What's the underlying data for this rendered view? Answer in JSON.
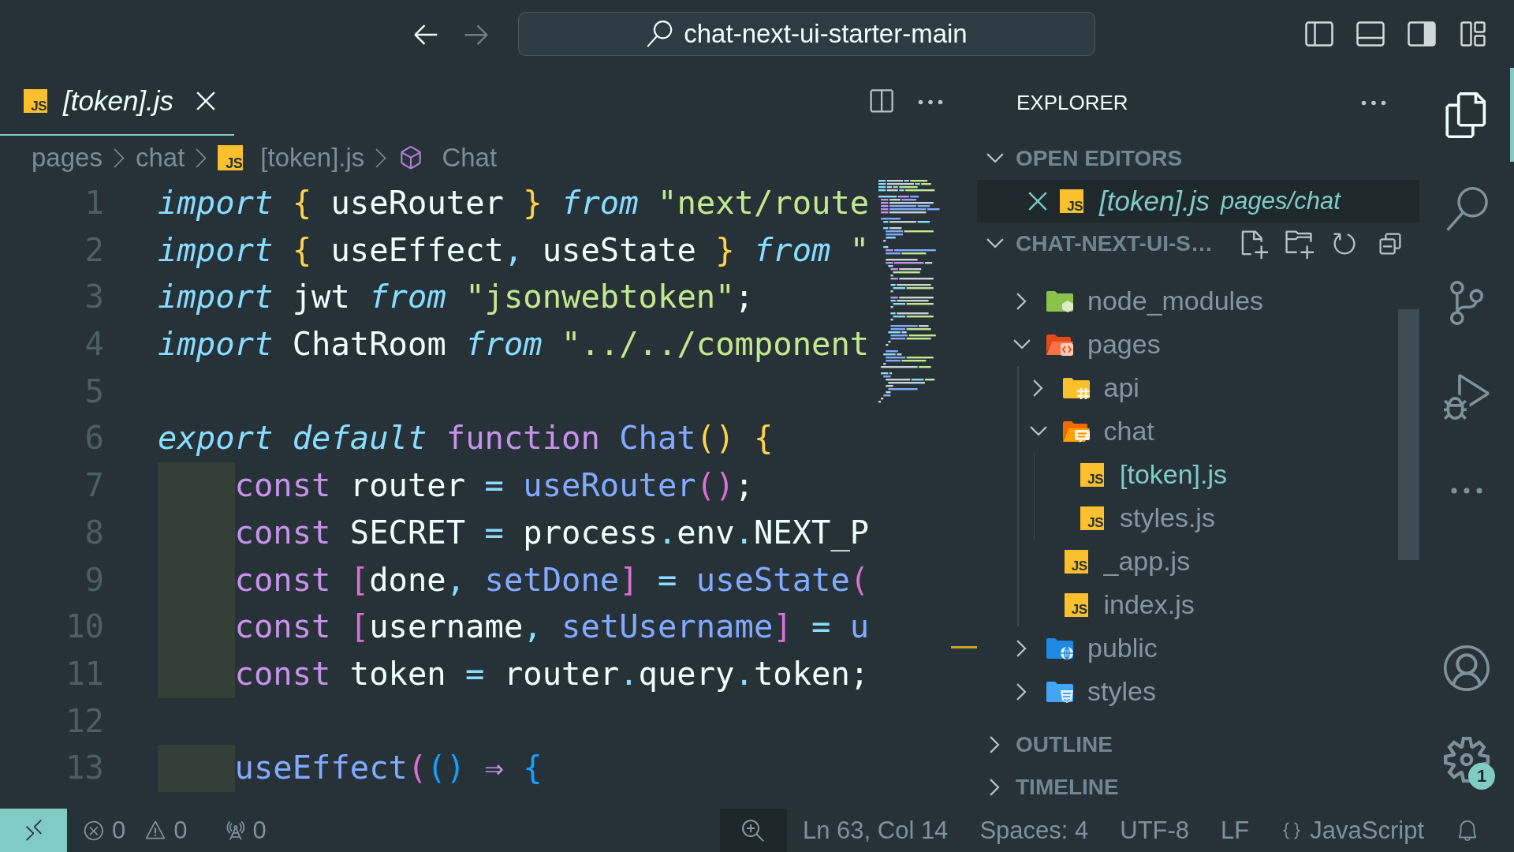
{
  "title_bar": {
    "navigation": [
      {
        "kind": "back",
        "disabled": false
      },
      {
        "kind": "forward",
        "disabled": true
      }
    ],
    "command_center": {
      "label": "chat-next-ui-starter-main"
    },
    "layout_toggles": [
      {
        "kind": "primary-sidebar",
        "on": false
      },
      {
        "kind": "panel",
        "on": false
      },
      {
        "kind": "secondary-sidebar",
        "on": true
      },
      {
        "kind": "customize"
      }
    ]
  },
  "editor": {
    "tabs": [
      {
        "label": "[token].js",
        "icon_text": "JS",
        "preview": true,
        "selected": true
      }
    ],
    "breadcrumbs": [
      {
        "label": "pages",
        "kind": "folder"
      },
      {
        "label": "chat",
        "kind": "folder"
      },
      {
        "label": "[token].js",
        "kind": "file",
        "icon_text": "JS"
      },
      {
        "label": "Chat",
        "kind": "symbol"
      }
    ],
    "code": [
      {
        "number": "1",
        "indented": false,
        "tokens": [
          {
            "kind": "keyword",
            "text": "import"
          },
          {
            "kind": "bracket1",
            "text": " {"
          },
          {
            "kind": "plain",
            "text": " useRouter "
          },
          {
            "kind": "bracket1",
            "text": "}"
          },
          {
            "kind": "keyword",
            "text": " from"
          },
          {
            "kind": "string",
            "text": " \"next/route"
          }
        ]
      },
      {
        "number": "2",
        "indented": false,
        "tokens": [
          {
            "kind": "keyword",
            "text": "import"
          },
          {
            "kind": "bracket1",
            "text": " {"
          },
          {
            "kind": "plain",
            "text": " useEffect"
          },
          {
            "kind": "punct",
            "text": ","
          },
          {
            "kind": "plain",
            "text": " useState "
          },
          {
            "kind": "bracket1",
            "text": "}"
          },
          {
            "kind": "keyword",
            "text": " from"
          },
          {
            "kind": "string",
            "text": " \""
          }
        ]
      },
      {
        "number": "3",
        "indented": false,
        "tokens": [
          {
            "kind": "keyword",
            "text": "import"
          },
          {
            "kind": "plain",
            "text": " jwt "
          },
          {
            "kind": "keyword",
            "text": "from"
          },
          {
            "kind": "string",
            "text": " \"jsonwebtoken\""
          },
          {
            "kind": "plain",
            "text": ";"
          }
        ]
      },
      {
        "number": "4",
        "indented": false,
        "tokens": [
          {
            "kind": "keyword",
            "text": "import"
          },
          {
            "kind": "plain",
            "text": " ChatRoom "
          },
          {
            "kind": "keyword",
            "text": "from"
          },
          {
            "kind": "string",
            "text": " \"../../component"
          }
        ]
      },
      {
        "number": "5",
        "indented": false
      },
      {
        "number": "6",
        "indented": false,
        "tokens": [
          {
            "kind": "keyword",
            "text": "export default"
          },
          {
            "kind": "storage",
            "text": " function"
          },
          {
            "kind": "function",
            "text": " Chat"
          },
          {
            "kind": "bracket1",
            "text": "()"
          },
          {
            "kind": "bracket1",
            "text": " {"
          }
        ]
      },
      {
        "number": "7",
        "indented": true,
        "tokens": [
          {
            "kind": "storage",
            "text": "const"
          },
          {
            "kind": "plain",
            "text": " router "
          },
          {
            "kind": "punct",
            "text": "="
          },
          {
            "kind": "function",
            "text": " useRouter"
          },
          {
            "kind": "bracket2",
            "text": "()"
          },
          {
            "kind": "plain",
            "text": ";"
          }
        ]
      },
      {
        "number": "8",
        "indented": true,
        "tokens": [
          {
            "kind": "storage",
            "text": "const"
          },
          {
            "kind": "plain",
            "text": " SECRET "
          },
          {
            "kind": "punct",
            "text": "="
          },
          {
            "kind": "plain",
            "text": " process"
          },
          {
            "kind": "punct",
            "text": "."
          },
          {
            "kind": "plain",
            "text": "env"
          },
          {
            "kind": "punct",
            "text": "."
          },
          {
            "kind": "plain",
            "text": "NEXT_P"
          }
        ]
      },
      {
        "number": "9",
        "indented": true,
        "tokens": [
          {
            "kind": "storage",
            "text": "const"
          },
          {
            "kind": "bracket2",
            "text": " ["
          },
          {
            "kind": "plain",
            "text": "done"
          },
          {
            "kind": "punct",
            "text": ","
          },
          {
            "kind": "function",
            "text": " setDone"
          },
          {
            "kind": "bracket2",
            "text": "]"
          },
          {
            "kind": "punct",
            "text": " ="
          },
          {
            "kind": "function",
            "text": " useState"
          },
          {
            "kind": "bracket2",
            "text": "("
          }
        ]
      },
      {
        "number": "10",
        "indented": true,
        "tokens": [
          {
            "kind": "storage",
            "text": "const"
          },
          {
            "kind": "bracket2",
            "text": " ["
          },
          {
            "kind": "plain",
            "text": "username"
          },
          {
            "kind": "punct",
            "text": ","
          },
          {
            "kind": "function",
            "text": " setUsername"
          },
          {
            "kind": "bracket2",
            "text": "]"
          },
          {
            "kind": "punct",
            "text": " ="
          },
          {
            "kind": "function",
            "text": " u"
          }
        ]
      },
      {
        "number": "11",
        "indented": true,
        "tokens": [
          {
            "kind": "storage",
            "text": "const"
          },
          {
            "kind": "plain",
            "text": " token "
          },
          {
            "kind": "punct",
            "text": "="
          },
          {
            "kind": "plain",
            "text": " router"
          },
          {
            "kind": "punct",
            "text": "."
          },
          {
            "kind": "plain",
            "text": "query"
          },
          {
            "kind": "punct",
            "text": "."
          },
          {
            "kind": "plain",
            "text": "token;"
          }
        ]
      },
      {
        "number": "12",
        "indented": false
      },
      {
        "number": "13",
        "indented": true,
        "tokens": [
          {
            "kind": "function",
            "text": "useEffect"
          },
          {
            "kind": "bracket2",
            "text": "("
          },
          {
            "kind": "bracket3",
            "text": "()"
          },
          {
            "kind": "storage",
            "text": " ⇒"
          },
          {
            "kind": "bracket3",
            "text": " {"
          }
        ]
      }
    ]
  },
  "sidebar": {
    "title": "EXPLORER",
    "open_editors": {
      "title": "OPEN EDITORS",
      "expanded": true,
      "items": [
        {
          "name": "[token].js",
          "path": "pages/chat",
          "icon_text": "JS",
          "preview": true,
          "selected": true
        }
      ]
    },
    "project": {
      "title": "CHAT-NEXT-UI-S…",
      "expanded": true,
      "tree": [
        {
          "name": "node_modules",
          "kind": "folder-node",
          "expanded": false,
          "selected": false
        },
        {
          "name": "pages",
          "kind": "folder-pages",
          "expanded": true,
          "selected": false,
          "children": [
            {
              "name": "api",
              "kind": "folder-api",
              "expanded": false,
              "selected": false
            },
            {
              "name": "chat",
              "kind": "folder-chat",
              "expanded": true,
              "selected": false,
              "children": [
                {
                  "name": "[token].js",
                  "kind": "js",
                  "icon_text": "JS",
                  "selected": true
                },
                {
                  "name": "styles.js",
                  "kind": "js",
                  "icon_text": "JS",
                  "selected": false
                }
              ]
            },
            {
              "name": "_app.js",
              "kind": "js",
              "icon_text": "JS",
              "selected": false
            },
            {
              "name": "index.js",
              "kind": "js",
              "icon_text": "JS",
              "selected": false
            }
          ]
        },
        {
          "name": "public",
          "kind": "folder-public",
          "expanded": false,
          "selected": false
        },
        {
          "name": "styles",
          "kind": "folder-styles",
          "expanded": false,
          "selected": false
        }
      ]
    },
    "collapsed_sections": [
      {
        "title": "OUTLINE",
        "expanded": false
      },
      {
        "title": "TIMELINE",
        "expanded": false
      }
    ]
  },
  "activity_bar": {
    "items": [
      {
        "kind": "explorer",
        "selected": true
      },
      {
        "kind": "search",
        "selected": false
      },
      {
        "kind": "source-control",
        "selected": false
      },
      {
        "kind": "run-debug",
        "selected": false
      },
      {
        "kind": "more",
        "selected": false
      }
    ],
    "bottom": [
      {
        "kind": "account"
      },
      {
        "kind": "settings",
        "badge": "1"
      }
    ]
  },
  "status_bar": {
    "problems": {
      "errors": "0",
      "warnings": "0"
    },
    "ports": "0",
    "items": [
      {
        "kind": "zoom"
      },
      {
        "kind": "text",
        "label": "Ln 63, Col 14"
      },
      {
        "kind": "text",
        "label": "Spaces: 4"
      },
      {
        "kind": "text",
        "label": "UTF-8"
      },
      {
        "kind": "text",
        "label": "LF"
      },
      {
        "kind": "language",
        "label": "JavaScript"
      },
      {
        "kind": "notifications"
      }
    ]
  }
}
